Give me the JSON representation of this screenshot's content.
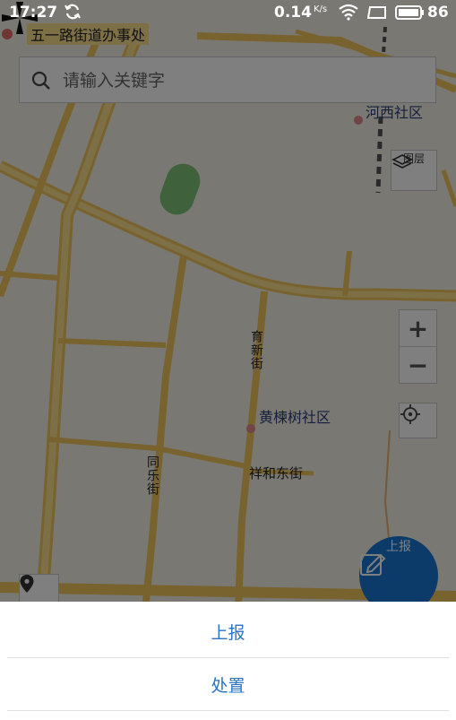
{
  "status_bar": {
    "time": "17:27",
    "network_speed": "0.14",
    "network_speed_unit": "K/s",
    "battery_level": "86",
    "icons": [
      "sync-icon",
      "wifi-icon",
      "screen-icon",
      "battery-icon"
    ]
  },
  "search": {
    "placeholder": "请输入关键字"
  },
  "map": {
    "labels": {
      "top_office": "五一路街道办事处",
      "community_1": "河西社区",
      "community_2": "黄楝树社区",
      "street_1": "祥和东街",
      "street_vertical_1": "育新街",
      "street_vertical_2": "同乐街"
    },
    "layer_button_label": "图层",
    "zoom_in": "+",
    "zoom_out": "−",
    "fab_label": "上报"
  },
  "sheet": {
    "items": [
      {
        "label": "上报"
      },
      {
        "label": "处置"
      }
    ]
  },
  "colors": {
    "accent": "#2a73c6",
    "fab": "#1976d2",
    "road": "#f2c95c"
  }
}
